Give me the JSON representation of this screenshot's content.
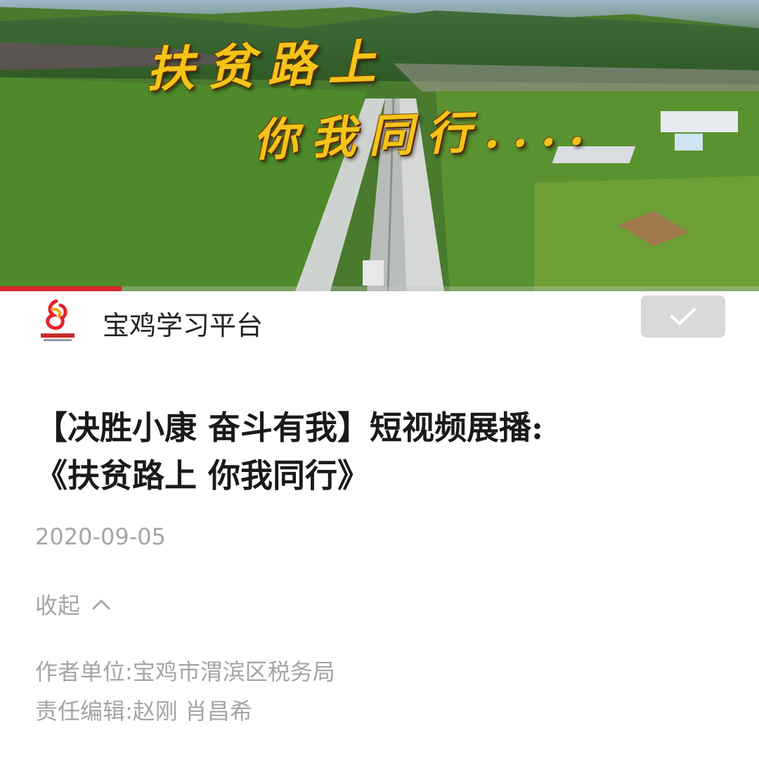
{
  "video": {
    "overlay_line1": "扶贫路上",
    "overlay_line2": "你我同行....",
    "progress": 0.16
  },
  "header": {
    "platform_name": "宝鸡学习平台",
    "follow_icon": "checkmark-icon"
  },
  "article": {
    "title_line1": "【决胜小康 奋斗有我】短视频展播:",
    "title_line2": "《扶贫路上 你我同行》",
    "date": "2020-09-05",
    "collapse_label": "收起",
    "author_label": "作者单位:",
    "author_value": "宝鸡市渭滨区税务局",
    "editor_label": "责任编辑:",
    "editor_value": "赵刚 肖昌希"
  },
  "colors": {
    "accent_red": "#d8262b",
    "overlay_gold": "#f3c419",
    "muted_text": "#a5a5a5"
  }
}
